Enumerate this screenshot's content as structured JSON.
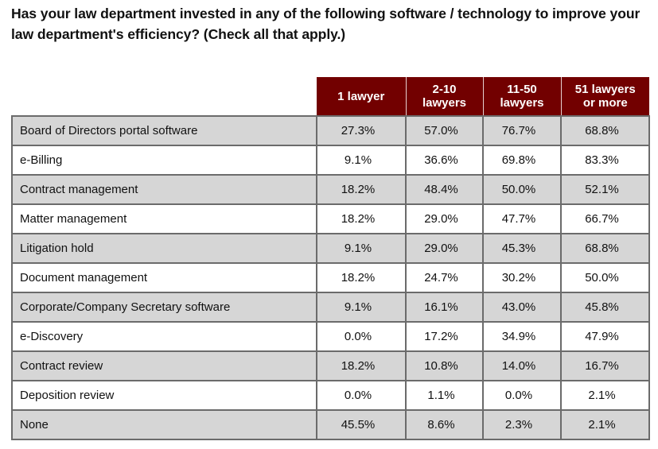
{
  "title": "Has your law department invested in any of the following software / technology to improve your law department's efficiency?  (Check all that apply.)",
  "colors": {
    "header_bg": "#720000",
    "header_text": "#ffffff",
    "row_shaded": "#d6d6d6",
    "row_plain": "#ffffff",
    "border": "#6b6b6b"
  },
  "chart_data": {
    "type": "table",
    "title": "Has your law department invested in any of the following software / technology to improve your law department's efficiency?  (Check all that apply.)",
    "columns": [
      "1 lawyer",
      "2-10 lawyers",
      "11-50 lawyers",
      "51 lawyers or more"
    ],
    "column_headers": [
      {
        "line1": "1 lawyer",
        "line2": ""
      },
      {
        "line1": "2-10",
        "line2": "lawyers"
      },
      {
        "line1": "11-50",
        "line2": "lawyers"
      },
      {
        "line1": "51 lawyers",
        "line2": "or more"
      }
    ],
    "rows": [
      {
        "label": "Board of Directors portal software",
        "values": [
          "27.3%",
          "57.0%",
          "76.7%",
          "68.8%"
        ]
      },
      {
        "label": "e-Billing",
        "values": [
          "9.1%",
          "36.6%",
          "69.8%",
          "83.3%"
        ]
      },
      {
        "label": "Contract management",
        "values": [
          "18.2%",
          "48.4%",
          "50.0%",
          "52.1%"
        ]
      },
      {
        "label": "Matter management",
        "values": [
          "18.2%",
          "29.0%",
          "47.7%",
          "66.7%"
        ]
      },
      {
        "label": "Litigation hold",
        "values": [
          "9.1%",
          "29.0%",
          "45.3%",
          "68.8%"
        ]
      },
      {
        "label": "Document management",
        "values": [
          "18.2%",
          "24.7%",
          "30.2%",
          "50.0%"
        ]
      },
      {
        "label": "Corporate/Company Secretary software",
        "values": [
          "9.1%",
          "16.1%",
          "43.0%",
          "45.8%"
        ]
      },
      {
        "label": "e-Discovery",
        "values": [
          "0.0%",
          "17.2%",
          "34.9%",
          "47.9%"
        ]
      },
      {
        "label": "Contract review",
        "values": [
          "18.2%",
          "10.8%",
          "14.0%",
          "16.7%"
        ]
      },
      {
        "label": "Deposition review",
        "values": [
          "0.0%",
          "1.1%",
          "0.0%",
          "2.1%"
        ]
      },
      {
        "label": "None",
        "values": [
          "45.5%",
          "8.6%",
          "2.3%",
          "2.1%"
        ]
      }
    ]
  }
}
